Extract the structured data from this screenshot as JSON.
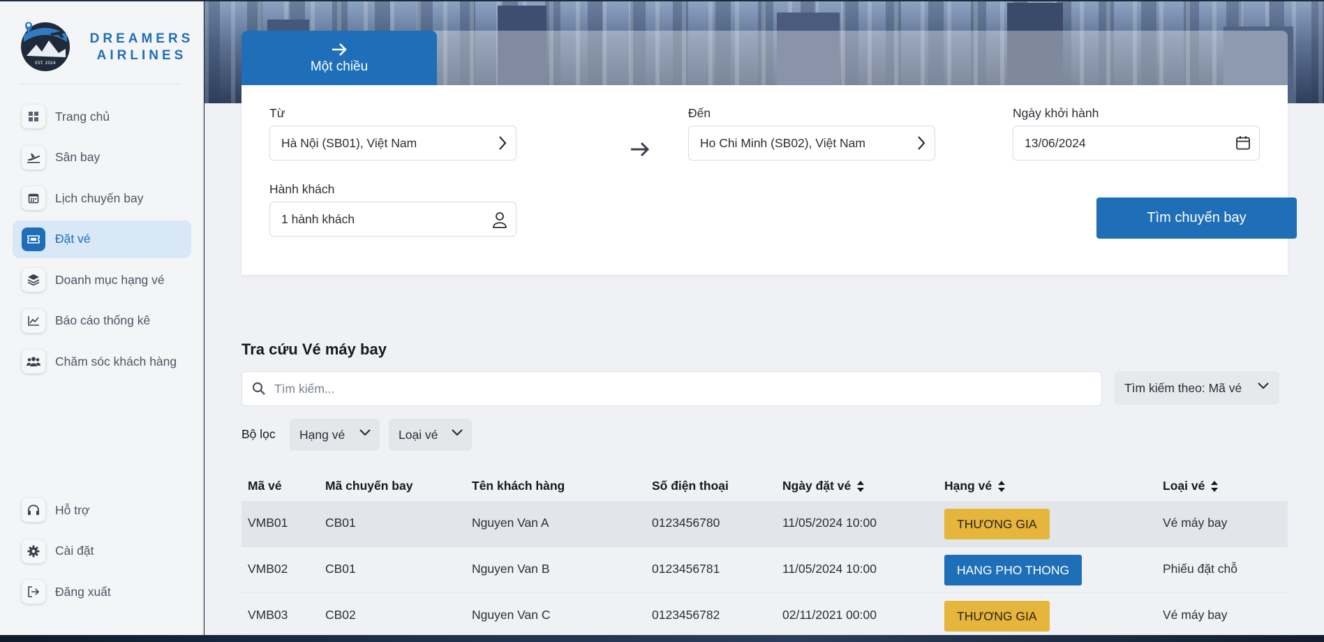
{
  "brand": {
    "line1": "DREAMERS",
    "line2": "AIRLINES",
    "badge_text": "EST. 2024"
  },
  "colors": {
    "primary": "#1e6fb8",
    "business": "#e6b53c",
    "sidebar_bg": "#f4f5f7"
  },
  "sidebar": {
    "items": [
      {
        "label": "Trang chủ",
        "icon": "windows-grid-icon",
        "active": false
      },
      {
        "label": "Sân bay",
        "icon": "airplane-takeoff-icon",
        "active": false
      },
      {
        "label": "Lịch chuyến bay",
        "icon": "calendar-icon",
        "active": false
      },
      {
        "label": "Đặt vé",
        "icon": "ticket-icon",
        "active": true
      },
      {
        "label": "Doanh mục hạng vé",
        "icon": "layers-icon",
        "active": false
      },
      {
        "label": "Báo cáo thống kê",
        "icon": "line-chart-icon",
        "active": false
      },
      {
        "label": "Chăm sóc khách hàng",
        "icon": "users-icon",
        "active": false
      }
    ],
    "bottom_items": [
      {
        "label": "Hỗ trợ",
        "icon": "headphones-icon"
      },
      {
        "label": "Cài đặt",
        "icon": "gear-icon"
      },
      {
        "label": "Đăng xuất",
        "icon": "logout-icon"
      }
    ]
  },
  "booking": {
    "tab_label": "Một chiều",
    "from_label": "Từ",
    "from_value": "Hà Nội (SB01), Việt Nam",
    "to_label": "Đến",
    "to_value": "Ho Chi Minh (SB02), Việt Nam",
    "date_label": "Ngày khởi hành",
    "date_value": "13/06/2024",
    "passenger_label": "Hành khách",
    "passenger_value": "1 hành khách",
    "search_button": "Tìm chuyến bay"
  },
  "lookup": {
    "title": "Tra cứu Vé máy bay",
    "search_placeholder": "Tìm kiếm...",
    "search_by": "Tìm kiếm theo: Mã vé",
    "filter_label": "Bộ lọc",
    "filter_class": "Hạng vé",
    "filter_type": "Loại vé"
  },
  "table": {
    "columns": [
      "Mã vé",
      "Mã chuyến bay",
      "Tên khách hàng",
      "Số điện thoại",
      "Ngày đặt vé",
      "Hạng vé",
      "Loại vé"
    ],
    "rows": [
      {
        "ticket": "VMB01",
        "flight": "CB01",
        "customer": "Nguyen Van A",
        "phone": "0123456780",
        "date": "11/05/2024 10:00",
        "class": "THƯƠNG GIA",
        "class_kind": "business",
        "type": "Vé máy bay"
      },
      {
        "ticket": "VMB02",
        "flight": "CB01",
        "customer": "Nguyen Van B",
        "phone": "0123456781",
        "date": "11/05/2024 10:00",
        "class": "HANG PHO THONG",
        "class_kind": "economy",
        "type": "Phiếu đặt chỗ"
      },
      {
        "ticket": "VMB03",
        "flight": "CB02",
        "customer": "Nguyen Van C",
        "phone": "0123456782",
        "date": "02/11/2021 00:00",
        "class": "THƯƠNG GIA",
        "class_kind": "business",
        "type": "Vé máy bay"
      }
    ]
  }
}
